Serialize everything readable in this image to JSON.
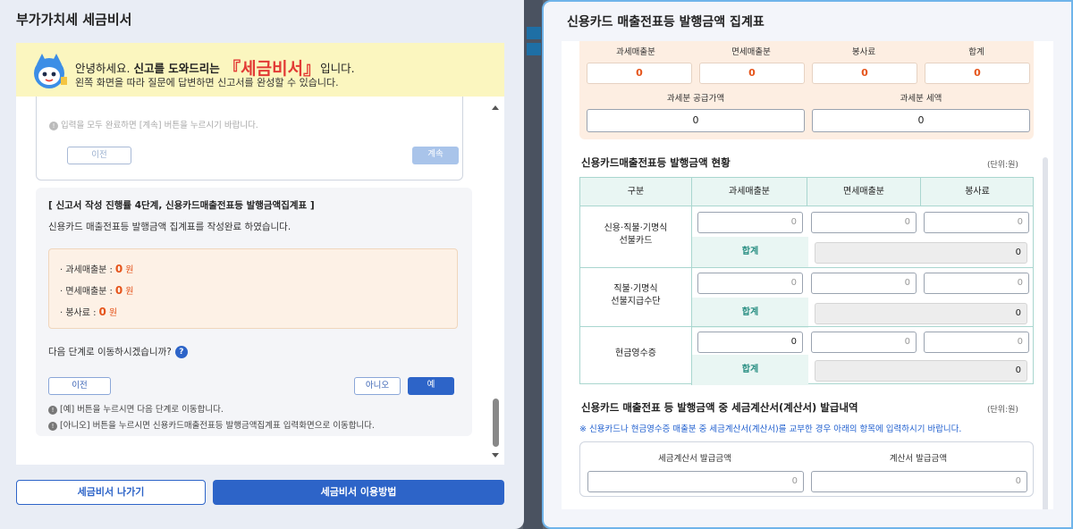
{
  "left_panel": {
    "title": "부가가치세 세금비서",
    "greeting": {
      "line1_pre": "안녕하세요. ",
      "line1_bold": "신고를 도와드리는 ",
      "line1_brand": "『세금비서』",
      "line1_post": "입니다.",
      "line2": "왼쪽 화면을 따라 질문에 답변하면 신고서를 완성할 수 있습니다."
    },
    "previous_step": {
      "note": "입력을 모두 완료하면 [계속] 버튼을 누르시기 바랍니다.",
      "prev_label": "이전",
      "next_label": "계속"
    },
    "current_step": {
      "title": "[ 신고서 작성 진행률 4단계, 신용카드매출전표등 발행금액집계표 ]",
      "description": "신용카드 매출전표등 발행금액 집계표를 작성완료 하였습니다.",
      "amounts": [
        {
          "label": "과세매출분 :",
          "value": "0",
          "unit": "원"
        },
        {
          "label": "면세매출분 :",
          "value": "0",
          "unit": "원"
        },
        {
          "label": "봉사료 :",
          "value": "0",
          "unit": "원"
        }
      ],
      "question": "다음 단계로 이동하시겠습니까?",
      "help_icon": "?",
      "prev_label": "이전",
      "no_label": "아니오",
      "yes_label": "예",
      "hint1": "[예] 버튼을 누르시면 다음 단계로 이동합니다.",
      "hint2": "[아니오] 버튼을 누르시면 신용카드매출전표등 발행금액집계표 입력화면으로 이동합니다."
    },
    "exit_label": "세금비서 나가기",
    "howto_label": "세금비서 이용방법"
  },
  "right_panel": {
    "title": "신용카드 매출전표등 발행금액 집계표",
    "summary": {
      "headers": [
        "과세매출분",
        "면세매출분",
        "봉사료",
        "합계"
      ],
      "values": [
        "0",
        "0",
        "0",
        "0"
      ],
      "supply_label": "과세분 공급가액",
      "supply_value": "0",
      "tax_label": "과세분 세액",
      "tax_value": "0"
    },
    "issuance": {
      "title": "신용카드매출전표등 발행금액 현황",
      "unit": "(단위:원)",
      "columns": [
        "구분",
        "과세매출분",
        "면세매출분",
        "봉사료"
      ],
      "rows": [
        {
          "label_l1": "신용·직불·기명식",
          "label_l2": "선불카드",
          "values": [
            "0",
            "0",
            "0"
          ],
          "sum_label": "합계",
          "sum_value": "0"
        },
        {
          "label_l1": "직불·기명식",
          "label_l2": "선불지급수단",
          "values": [
            "0",
            "0",
            "0"
          ],
          "sum_label": "합계",
          "sum_value": "0"
        },
        {
          "label_l1": "현금영수증",
          "label_l2": "",
          "values": [
            "0",
            "0",
            "0"
          ],
          "sum_label": "합계",
          "sum_value": "0"
        }
      ]
    },
    "tax_invoice": {
      "title": "신용카드 매출전표 등 발행금액 중 세금계산서(계산서) 발급내역",
      "unit": "(단위:원)",
      "note": "※ 신용카드나 현금영수증 매출분 중 세금계산서(계산서)를 교부한 경우 아래의 항목에 입력하시기 바랍니다.",
      "col1": "세금계산서 발급금액",
      "col1_value": "0",
      "col2": "계산서 발급금액",
      "col2_value": "0"
    }
  },
  "colors": {
    "accent": "#2d64c8",
    "amount": "#e5541b",
    "brand_red": "#e23a35",
    "teal": "#2a8f83"
  }
}
